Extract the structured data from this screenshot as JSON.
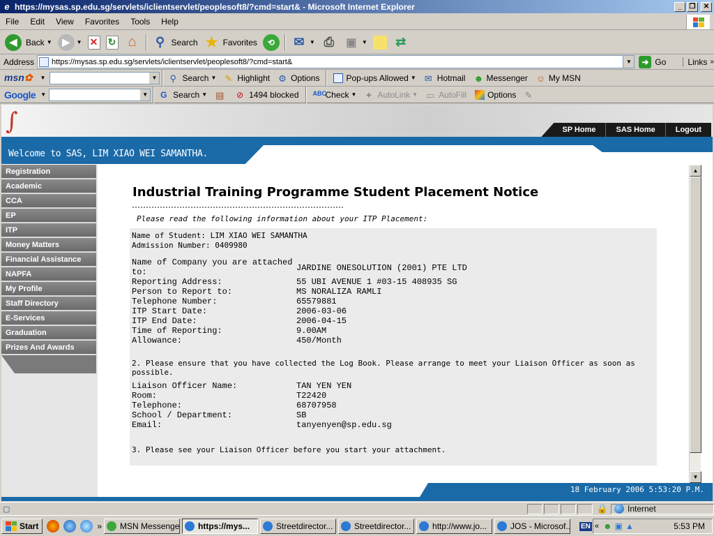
{
  "window": {
    "title": "https://mysas.sp.edu.sg/servlets/iclientservlet/peoplesoft8/?cmd=start& - Microsoft Internet Explorer"
  },
  "menu": [
    "File",
    "Edit",
    "View",
    "Favorites",
    "Tools",
    "Help"
  ],
  "toolbar": {
    "back": "Back",
    "search": "Search",
    "favorites": "Favorites"
  },
  "address": {
    "label": "Address",
    "url": "https://mysas.sp.edu.sg/servlets/iclientservlet/peoplesoft8/?cmd=start&",
    "go": "Go",
    "links": "Links"
  },
  "msnbar": {
    "logo": "msn",
    "search": "Search",
    "highlight": "Highlight",
    "options": "Options",
    "popups": "Pop-ups Allowed",
    "hotmail": "Hotmail",
    "messenger": "Messenger",
    "mymsn": "My MSN"
  },
  "googlebar": {
    "logo": "Google",
    "search": "Search",
    "blocked": "1494 blocked",
    "check": "Check",
    "autolink": "AutoLink",
    "autofill": "AutoFill",
    "options": "Options"
  },
  "site": {
    "nav": [
      "SP Home",
      "SAS Home",
      "Logout"
    ],
    "welcome": "Welcome to SAS, LIM XIAO WEI SAMANTHA.",
    "sidebar": [
      "Registration",
      "Academic",
      "CCA",
      "EP",
      "ITP",
      "Money Matters",
      "Financial Assistance",
      "NAPFA",
      "My Profile",
      "Staff Directory",
      "E-Services",
      "Graduation",
      "Prizes And Awards"
    ],
    "footer_date": "18 February 2006 5:53:20 P.M."
  },
  "notice": {
    "title": "Industrial Training Programme Student Placement Notice",
    "intro": "Please read the following information about your ITP Placement:",
    "student_name": "Name of Student: LIM XIAO WEI SAMANTHA",
    "admission": "Admission Number: 0409980",
    "company_label_1": "Name of Company you are attached",
    "company_label_2": "to:",
    "company": "JARDINE ONESOLUTION (2001) PTE LTD",
    "placement": [
      {
        "label": "Reporting Address:",
        "value": "55 UBI AVENUE 1 #03-15 408935 SG"
      },
      {
        "label": "Person to Report to:",
        "value": "MS NORALIZA RAMLI"
      },
      {
        "label": "Telephone Number:",
        "value": "65579881"
      },
      {
        "label": "ITP Start Date:",
        "value": "2006-03-06"
      },
      {
        "label": "ITP End Date:",
        "value": "2006-04-15"
      },
      {
        "label": "Time of Reporting:",
        "value": "9.00AM"
      },
      {
        "label": "Allowance:",
        "value": "450/Month"
      }
    ],
    "note2": "2. Please ensure that you have collected the Log Book. Please arrange to meet your Liaison Officer as soon as possible.",
    "liaison": [
      {
        "label": "Liaison Officer Name:",
        "value": "TAN YEN YEN"
      },
      {
        "label": "Room:",
        "value": "T22420"
      },
      {
        "label": "Telephone:",
        "value": "68707958"
      },
      {
        "label": "School / Department:",
        "value": "SB"
      },
      {
        "label": "Email:",
        "value": "tanyenyen@sp.edu.sg"
      }
    ],
    "note3": "3. Please see your Liaison Officer before you start your attachment."
  },
  "statusbar": {
    "zone": "Internet"
  },
  "taskbar": {
    "start": "Start",
    "tasks": [
      "MSN Messenger",
      "https://mys...",
      "Streetdirector...",
      "Streetdirector...",
      "http://www.jo...",
      "JOS - Microsof..."
    ],
    "lang": "EN",
    "clock": "5:53 PM"
  }
}
